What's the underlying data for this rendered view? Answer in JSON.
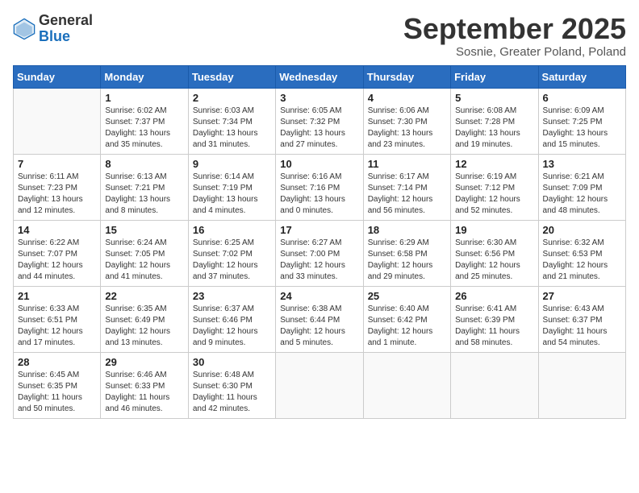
{
  "logo": {
    "general": "General",
    "blue": "Blue"
  },
  "title": "September 2025",
  "subtitle": "Sosnie, Greater Poland, Poland",
  "headers": [
    "Sunday",
    "Monday",
    "Tuesday",
    "Wednesday",
    "Thursday",
    "Friday",
    "Saturday"
  ],
  "weeks": [
    [
      {
        "day": "",
        "info": ""
      },
      {
        "day": "1",
        "info": "Sunrise: 6:02 AM\nSunset: 7:37 PM\nDaylight: 13 hours\nand 35 minutes."
      },
      {
        "day": "2",
        "info": "Sunrise: 6:03 AM\nSunset: 7:34 PM\nDaylight: 13 hours\nand 31 minutes."
      },
      {
        "day": "3",
        "info": "Sunrise: 6:05 AM\nSunset: 7:32 PM\nDaylight: 13 hours\nand 27 minutes."
      },
      {
        "day": "4",
        "info": "Sunrise: 6:06 AM\nSunset: 7:30 PM\nDaylight: 13 hours\nand 23 minutes."
      },
      {
        "day": "5",
        "info": "Sunrise: 6:08 AM\nSunset: 7:28 PM\nDaylight: 13 hours\nand 19 minutes."
      },
      {
        "day": "6",
        "info": "Sunrise: 6:09 AM\nSunset: 7:25 PM\nDaylight: 13 hours\nand 15 minutes."
      }
    ],
    [
      {
        "day": "7",
        "info": "Sunrise: 6:11 AM\nSunset: 7:23 PM\nDaylight: 13 hours\nand 12 minutes."
      },
      {
        "day": "8",
        "info": "Sunrise: 6:13 AM\nSunset: 7:21 PM\nDaylight: 13 hours\nand 8 minutes."
      },
      {
        "day": "9",
        "info": "Sunrise: 6:14 AM\nSunset: 7:19 PM\nDaylight: 13 hours\nand 4 minutes."
      },
      {
        "day": "10",
        "info": "Sunrise: 6:16 AM\nSunset: 7:16 PM\nDaylight: 13 hours\nand 0 minutes."
      },
      {
        "day": "11",
        "info": "Sunrise: 6:17 AM\nSunset: 7:14 PM\nDaylight: 12 hours\nand 56 minutes."
      },
      {
        "day": "12",
        "info": "Sunrise: 6:19 AM\nSunset: 7:12 PM\nDaylight: 12 hours\nand 52 minutes."
      },
      {
        "day": "13",
        "info": "Sunrise: 6:21 AM\nSunset: 7:09 PM\nDaylight: 12 hours\nand 48 minutes."
      }
    ],
    [
      {
        "day": "14",
        "info": "Sunrise: 6:22 AM\nSunset: 7:07 PM\nDaylight: 12 hours\nand 44 minutes."
      },
      {
        "day": "15",
        "info": "Sunrise: 6:24 AM\nSunset: 7:05 PM\nDaylight: 12 hours\nand 41 minutes."
      },
      {
        "day": "16",
        "info": "Sunrise: 6:25 AM\nSunset: 7:02 PM\nDaylight: 12 hours\nand 37 minutes."
      },
      {
        "day": "17",
        "info": "Sunrise: 6:27 AM\nSunset: 7:00 PM\nDaylight: 12 hours\nand 33 minutes."
      },
      {
        "day": "18",
        "info": "Sunrise: 6:29 AM\nSunset: 6:58 PM\nDaylight: 12 hours\nand 29 minutes."
      },
      {
        "day": "19",
        "info": "Sunrise: 6:30 AM\nSunset: 6:56 PM\nDaylight: 12 hours\nand 25 minutes."
      },
      {
        "day": "20",
        "info": "Sunrise: 6:32 AM\nSunset: 6:53 PM\nDaylight: 12 hours\nand 21 minutes."
      }
    ],
    [
      {
        "day": "21",
        "info": "Sunrise: 6:33 AM\nSunset: 6:51 PM\nDaylight: 12 hours\nand 17 minutes."
      },
      {
        "day": "22",
        "info": "Sunrise: 6:35 AM\nSunset: 6:49 PM\nDaylight: 12 hours\nand 13 minutes."
      },
      {
        "day": "23",
        "info": "Sunrise: 6:37 AM\nSunset: 6:46 PM\nDaylight: 12 hours\nand 9 minutes."
      },
      {
        "day": "24",
        "info": "Sunrise: 6:38 AM\nSunset: 6:44 PM\nDaylight: 12 hours\nand 5 minutes."
      },
      {
        "day": "25",
        "info": "Sunrise: 6:40 AM\nSunset: 6:42 PM\nDaylight: 12 hours\nand 1 minute."
      },
      {
        "day": "26",
        "info": "Sunrise: 6:41 AM\nSunset: 6:39 PM\nDaylight: 11 hours\nand 58 minutes."
      },
      {
        "day": "27",
        "info": "Sunrise: 6:43 AM\nSunset: 6:37 PM\nDaylight: 11 hours\nand 54 minutes."
      }
    ],
    [
      {
        "day": "28",
        "info": "Sunrise: 6:45 AM\nSunset: 6:35 PM\nDaylight: 11 hours\nand 50 minutes."
      },
      {
        "day": "29",
        "info": "Sunrise: 6:46 AM\nSunset: 6:33 PM\nDaylight: 11 hours\nand 46 minutes."
      },
      {
        "day": "30",
        "info": "Sunrise: 6:48 AM\nSunset: 6:30 PM\nDaylight: 11 hours\nand 42 minutes."
      },
      {
        "day": "",
        "info": ""
      },
      {
        "day": "",
        "info": ""
      },
      {
        "day": "",
        "info": ""
      },
      {
        "day": "",
        "info": ""
      }
    ]
  ]
}
